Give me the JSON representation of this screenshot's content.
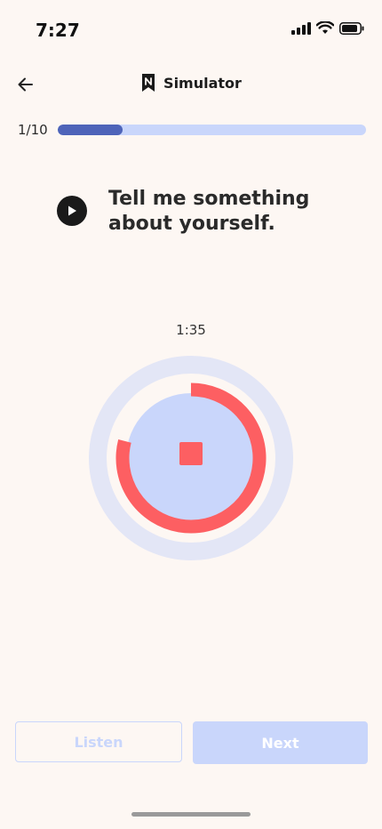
{
  "status_bar": {
    "time": "7:27"
  },
  "header": {
    "title": "Simulator",
    "back_icon": "arrow-left-icon",
    "logo_icon": "bookmark-logo-icon"
  },
  "progress": {
    "label": "1/10",
    "fraction": 0.21
  },
  "question": {
    "text": "Tell me something about yourself."
  },
  "recorder": {
    "timer": "1:35",
    "record_progress": 0.79
  },
  "buttons": {
    "listen_label": "Listen",
    "next_label": "Next"
  },
  "colors": {
    "background": "#fdf7f3",
    "progress_track": "#c9d6fb",
    "progress_fill": "#4e64b9",
    "record_red": "#fd5f62",
    "outer_ring": "#e3e6f6",
    "inner_circle": "#c9d6fb"
  }
}
